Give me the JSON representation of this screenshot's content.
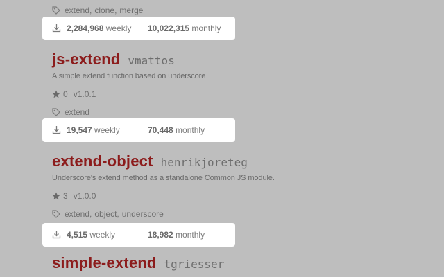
{
  "colors": {
    "background": "#bebebe",
    "package_name": "#8c1c1c",
    "download_box": "#ffffff",
    "muted_text": "#6f6f6f"
  },
  "icons": {
    "tag": "tag-icon",
    "download": "download-icon",
    "star": "star-icon"
  },
  "packages": [
    {
      "tags": [
        "extend",
        "clone",
        "merge"
      ],
      "downloads": {
        "weekly_num": "2,284,968",
        "weekly_label": "weekly",
        "monthly_num": "10,022,315",
        "monthly_label": "monthly"
      }
    },
    {
      "name": "js-extend",
      "author": "vmattos",
      "description": "A simple extend function based on underscore",
      "stars": "0",
      "version": "v1.0.1",
      "tags": [
        "extend"
      ],
      "downloads": {
        "weekly_num": "19,547",
        "weekly_label": "weekly",
        "monthly_num": "70,448",
        "monthly_label": "monthly"
      }
    },
    {
      "name": "extend-object",
      "author": "henrikjoreteg",
      "description": "Underscore's extend method as a standalone Common JS module.",
      "stars": "3",
      "version": "v1.0.0",
      "tags": [
        "extend",
        "object",
        "underscore"
      ],
      "downloads": {
        "weekly_num": "4,515",
        "weekly_label": "weekly",
        "monthly_num": "18,982",
        "monthly_label": "monthly"
      }
    },
    {
      "name": "simple-extend",
      "author": "tgriesser"
    }
  ]
}
